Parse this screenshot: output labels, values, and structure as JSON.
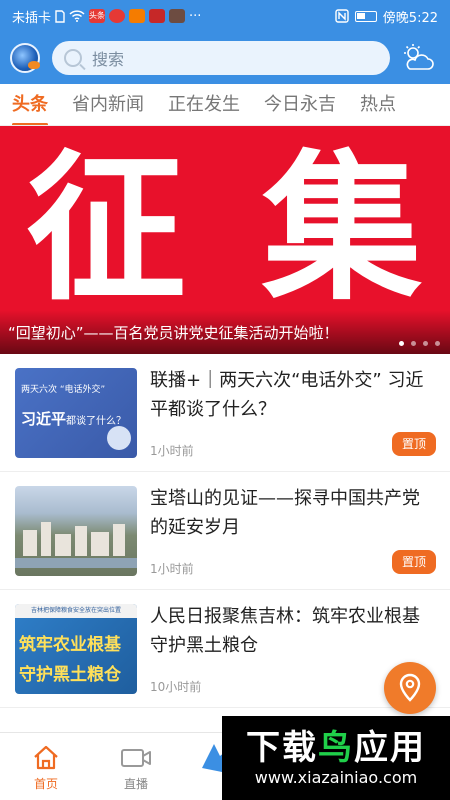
{
  "status_bar": {
    "carrier": "未插卡",
    "mini_app_labels": [
      "头条"
    ],
    "time": "傍晚5:22",
    "more": "···"
  },
  "app_bar": {
    "search_placeholder": "搜索",
    "accent_color": "#3b8fe3"
  },
  "tabs": [
    {
      "label": "头条",
      "active": true
    },
    {
      "label": "省内新闻",
      "active": false
    },
    {
      "label": "正在发生",
      "active": false
    },
    {
      "label": "今日永吉",
      "active": false
    },
    {
      "label": "热点",
      "active": false
    }
  ],
  "banner": {
    "big_chars": [
      "征",
      "集"
    ],
    "caption": "“回望初心”——百名党员讲党史征集活动开始啦！",
    "total_slides": 4,
    "current_slide": 1,
    "color": "#e8112b"
  },
  "news": [
    {
      "title": "联播+｜两天六次“电话外交” 习近平都谈了什么？",
      "time": "1小时前",
      "pin": "置顶",
      "thumb_text_top": "两天六次 “电话外交”",
      "thumb_text_big": "习近平",
      "thumb_text_small": "都谈了什么？"
    },
    {
      "title": "宝塔山的见证——探寻中国共产党的延安岁月",
      "time": "1小时前",
      "pin": "置顶"
    },
    {
      "title": "人民日报聚焦吉林：筑牢农业根基 守护黑土粮仓",
      "time": "10小时前",
      "thumb_header": "吉林把保障粮食安全放在突出位置",
      "thumb_line1": "筑牢农业根基",
      "thumb_line2": "守护黑土粮仓"
    }
  ],
  "bottom_nav": [
    {
      "label": "首页",
      "icon": "home-icon",
      "active": true
    },
    {
      "label": "直播",
      "icon": "video-camera-icon",
      "active": false
    }
  ],
  "watermark": {
    "brand_part1": "下载",
    "brand_part2": "鸟",
    "brand_part3": "应用",
    "url": "www.xiazainiao.com"
  },
  "accent_orange": "#ef6b22"
}
